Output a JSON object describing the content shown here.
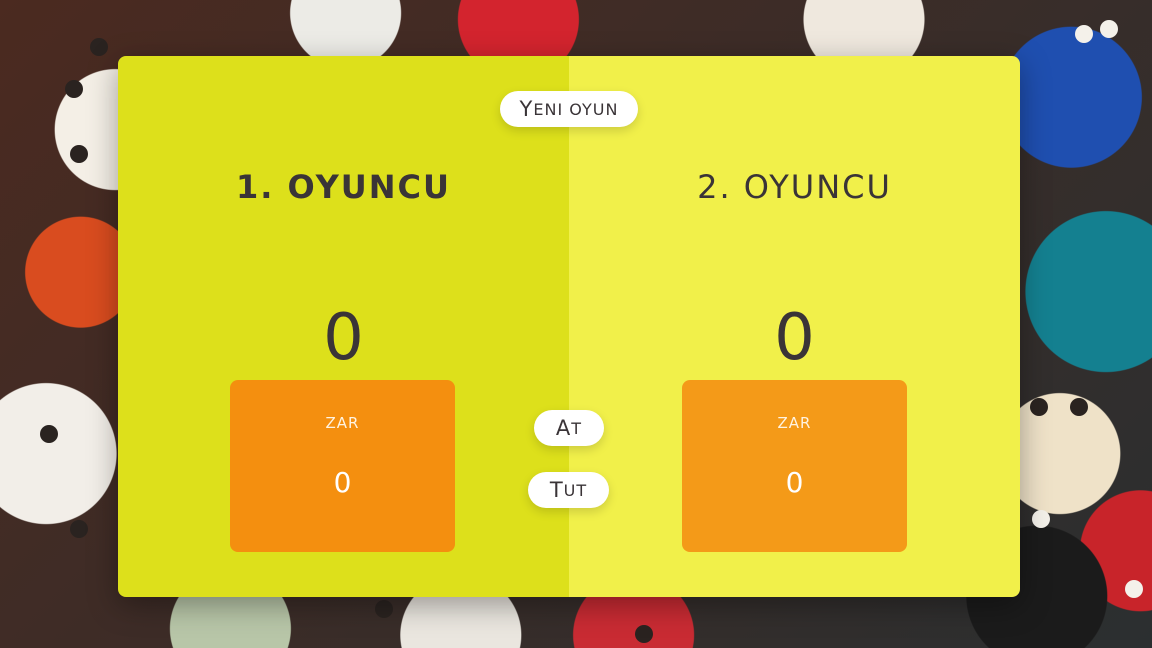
{
  "players": [
    {
      "name": "1. OYUNCU",
      "score": "0",
      "current_label": "ZAR",
      "current_score": "0"
    },
    {
      "name": "2. OYUNCU",
      "score": "0",
      "current_label": "ZAR",
      "current_score": "0"
    }
  ],
  "buttons": {
    "new_game_initial": "Y",
    "new_game_rest": "ENI OYUN",
    "roll_initial": "A",
    "roll_rest": "T",
    "hold_initial": "T",
    "hold_rest": "UT"
  },
  "colors": {
    "active_panel": "#dde01b",
    "inactive_panel": "#f1f04a",
    "current_box": "#f48f0f",
    "text": "#3a3437"
  },
  "active_player": 1
}
